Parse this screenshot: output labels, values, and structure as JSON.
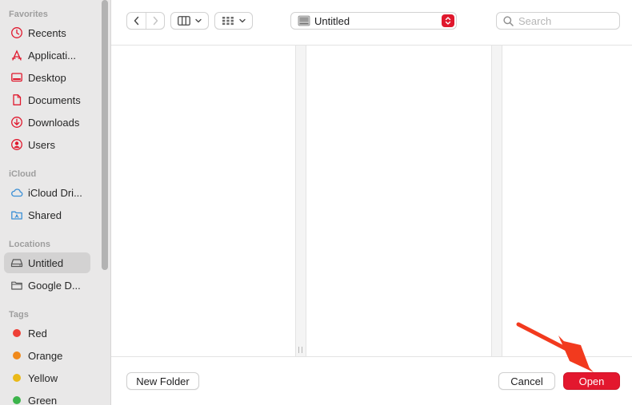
{
  "sidebar": {
    "favorites_title": "Favorites",
    "favorites": [
      {
        "label": "Recents",
        "icon": "clock-icon"
      },
      {
        "label": "Applicati...",
        "icon": "applications-icon"
      },
      {
        "label": "Desktop",
        "icon": "desktop-icon"
      },
      {
        "label": "Documents",
        "icon": "document-icon"
      },
      {
        "label": "Downloads",
        "icon": "download-icon"
      },
      {
        "label": "Users",
        "icon": "user-icon"
      }
    ],
    "icloud_title": "iCloud",
    "icloud": [
      {
        "label": "iCloud Dri...",
        "icon": "cloud-icon"
      },
      {
        "label": "Shared",
        "icon": "shared-folder-icon"
      }
    ],
    "locations_title": "Locations",
    "locations": [
      {
        "label": "Untitled",
        "icon": "drive-icon",
        "selected": true
      },
      {
        "label": "Google D...",
        "icon": "folder-icon"
      }
    ],
    "tags_title": "Tags",
    "tags": [
      {
        "label": "Red",
        "color": "#ee4037"
      },
      {
        "label": "Orange",
        "color": "#f0891b"
      },
      {
        "label": "Yellow",
        "color": "#eab919"
      },
      {
        "label": "Green",
        "color": "#3cb44b"
      }
    ]
  },
  "toolbar": {
    "location_name": "Untitled",
    "search_placeholder": "Search"
  },
  "footer": {
    "new_folder_label": "New Folder",
    "cancel_label": "Cancel",
    "open_label": "Open"
  },
  "colors": {
    "accent": "#e3172e",
    "sidebar_icon": "#e0182d",
    "icloud_icon": "#3a8fd6",
    "arrow": "#f23a1e"
  }
}
